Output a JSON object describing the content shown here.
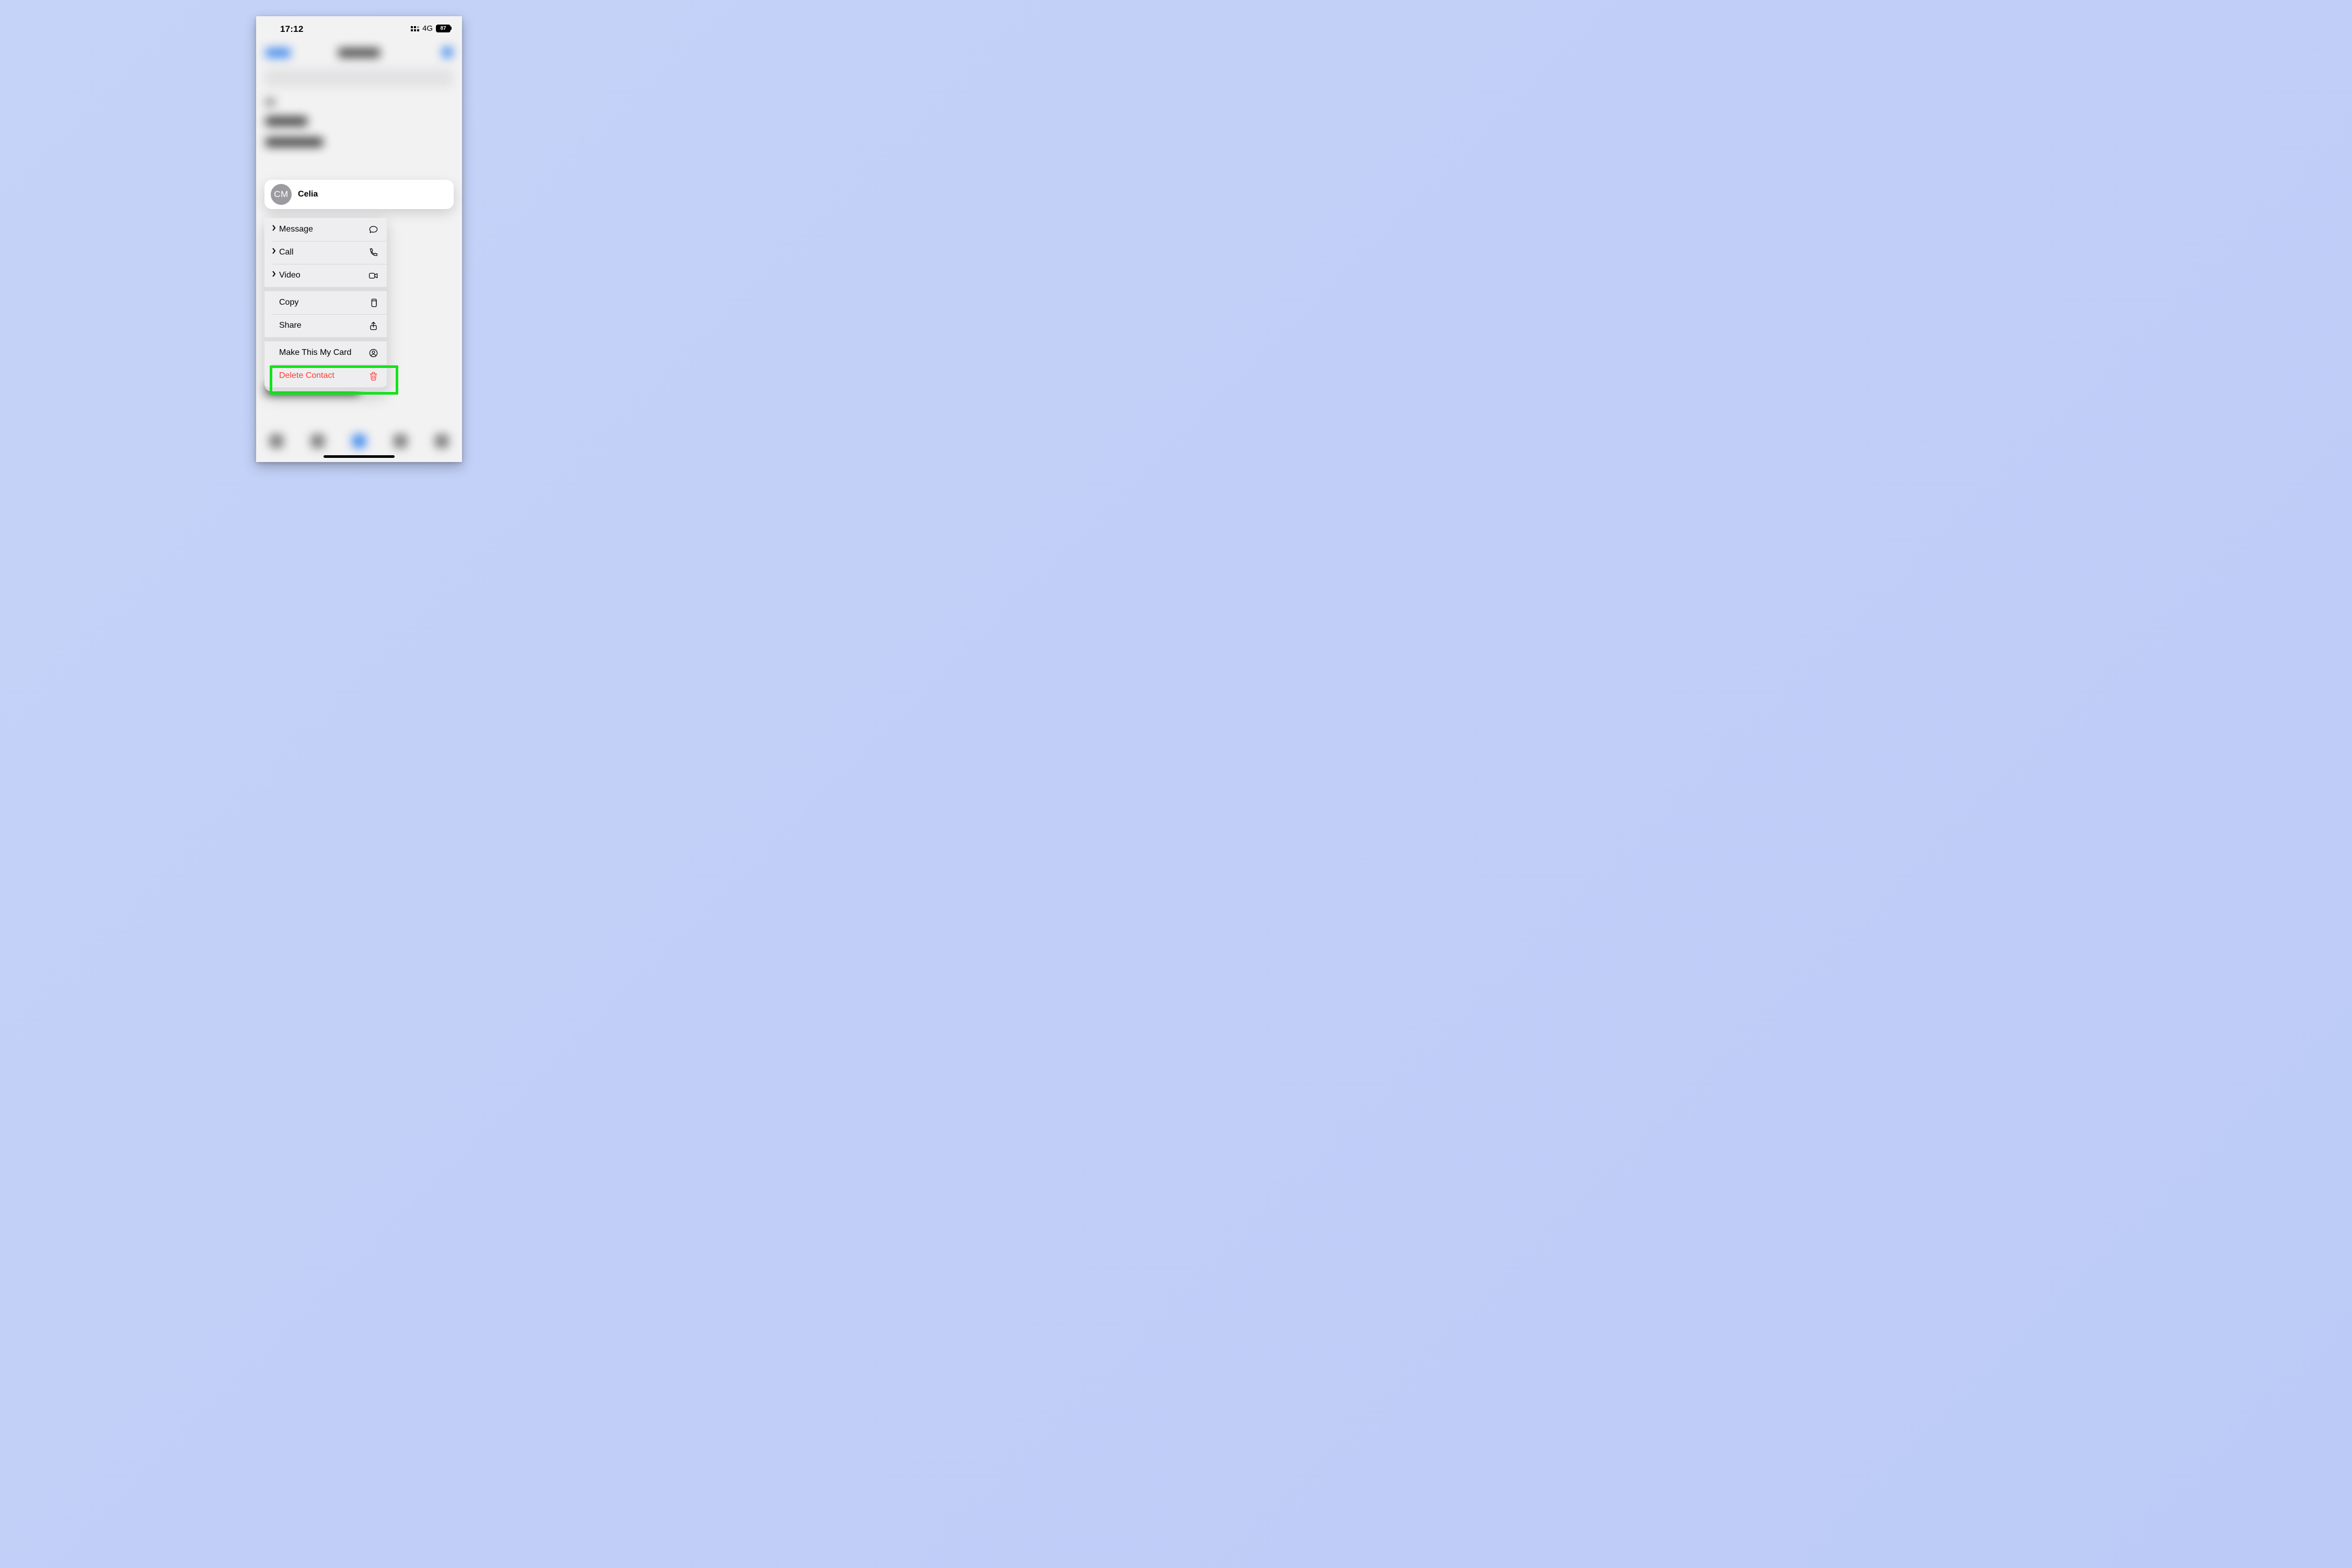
{
  "status": {
    "time": "17:12",
    "network": "4G",
    "battery": "87"
  },
  "contact": {
    "initials": "CM",
    "name": "Celia"
  },
  "menu": {
    "message": "Message",
    "call": "Call",
    "video": "Video",
    "copy": "Copy",
    "share": "Share",
    "make_card": "Make This My Card",
    "delete": "Delete Contact"
  }
}
